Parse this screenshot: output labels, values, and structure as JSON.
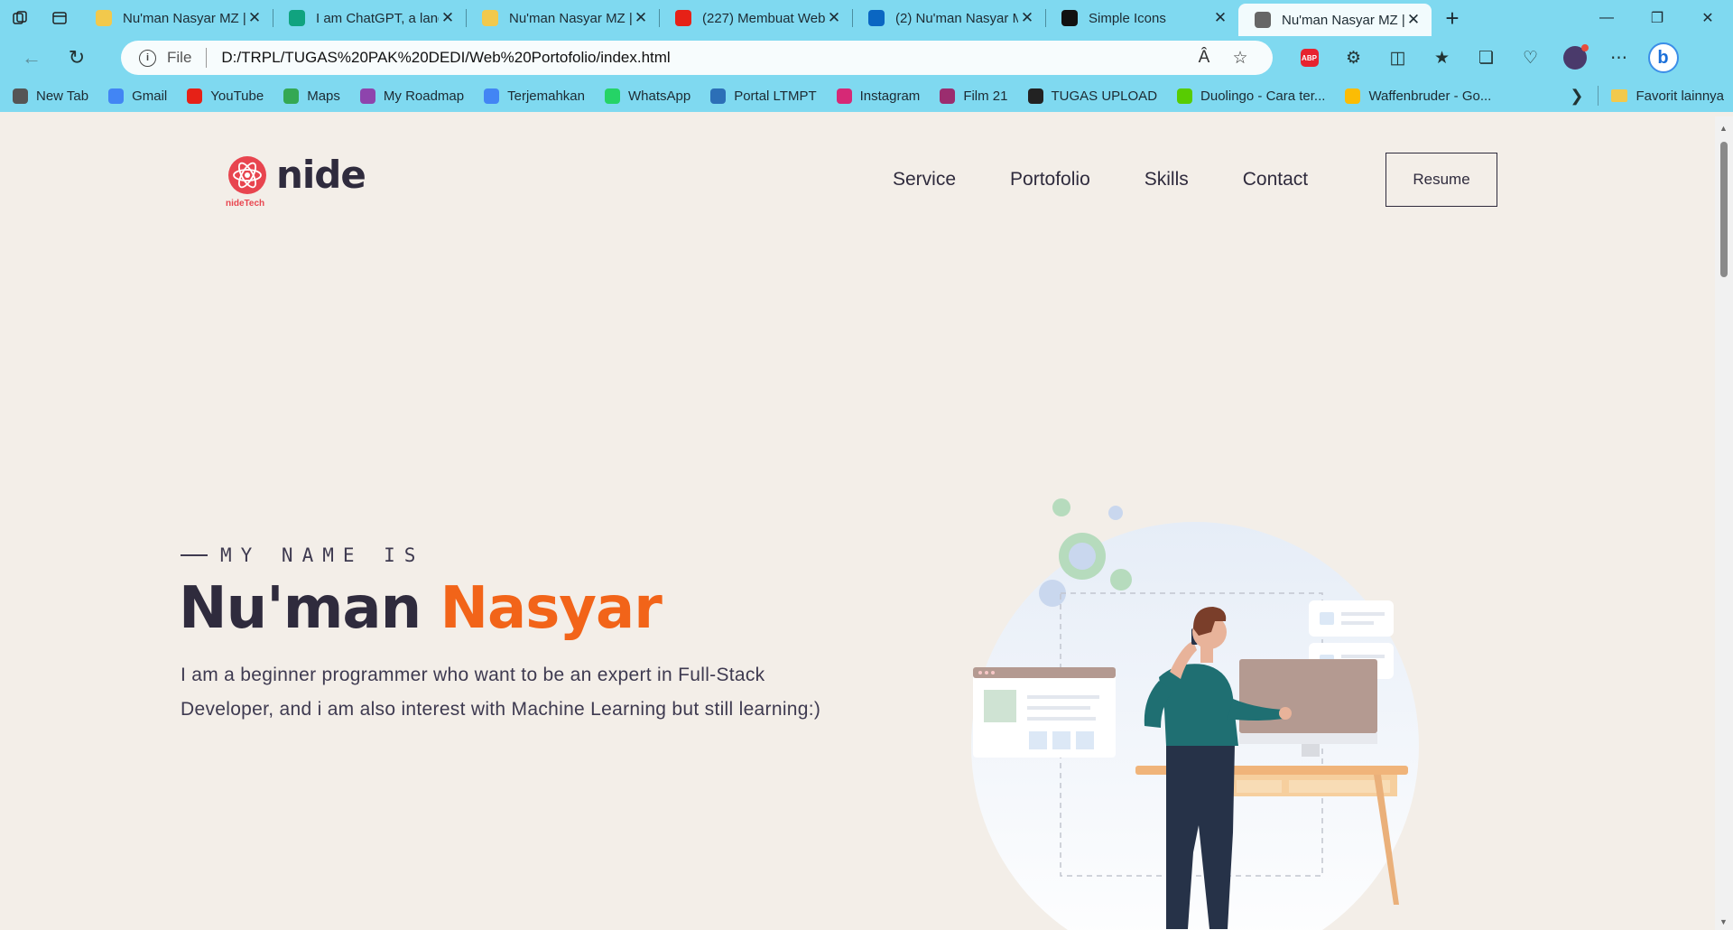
{
  "browser": {
    "tabs": [
      {
        "title": "Nu'man Nasyar MZ |",
        "favicon": "yellow-bars-favicon",
        "color": "#f2c94c"
      },
      {
        "title": "I am ChatGPT, a lang",
        "favicon": "chatgpt-favicon",
        "color": "#10a37f"
      },
      {
        "title": "Nu'man Nasyar MZ |",
        "favicon": "yellow-bars-favicon",
        "color": "#f2c94c"
      },
      {
        "title": "(227) Membuat Web",
        "favicon": "youtube-favicon",
        "color": "#e62117"
      },
      {
        "title": "(2) Nu'man Nasyar M",
        "favicon": "linkedin-favicon",
        "color": "#0a66c2"
      },
      {
        "title": "Simple Icons",
        "favicon": "simpleicons-favicon",
        "color": "#111111"
      },
      {
        "title": "Nu'man Nasyar MZ |",
        "favicon": "page-favicon",
        "color": "#666666",
        "active": true
      }
    ],
    "address": {
      "label": "File",
      "url": "D:/TRPL/TUGAS%20PAK%20DEDI/Web%20Portofolio/index.html"
    },
    "bookmarks": [
      {
        "label": "New Tab",
        "icon": "page-icon",
        "color": "#555555"
      },
      {
        "label": "Gmail",
        "icon": "google-icon",
        "color": "#4285f4"
      },
      {
        "label": "YouTube",
        "icon": "youtube-icon",
        "color": "#e62117"
      },
      {
        "label": "Maps",
        "icon": "google-icon",
        "color": "#34a853"
      },
      {
        "label": "My Roadmap",
        "icon": "roadmap-icon",
        "color": "#8e44ad"
      },
      {
        "label": "Terjemahkan",
        "icon": "translate-icon",
        "color": "#4285f4"
      },
      {
        "label": "WhatsApp",
        "icon": "whatsapp-icon",
        "color": "#25d366"
      },
      {
        "label": "Portal LTMPT",
        "icon": "ltmpt-icon",
        "color": "#2c6fb7"
      },
      {
        "label": "Instagram",
        "icon": "instagram-icon",
        "color": "#d62976"
      },
      {
        "label": "Film 21",
        "icon": "film-icon",
        "color": "#9b2d6f"
      },
      {
        "label": "TUGAS UPLOAD",
        "icon": "upload-icon",
        "color": "#222222"
      },
      {
        "label": "Duolingo - Cara ter...",
        "icon": "duolingo-icon",
        "color": "#58cc02"
      },
      {
        "label": "Waffenbruder - Go...",
        "icon": "drive-icon",
        "color": "#fbbc04"
      }
    ],
    "other_favorites": "Favorit lainnya"
  },
  "site": {
    "logo_text": "nide",
    "logo_sub": "nideTech",
    "nav": [
      "Service",
      "Portofolio",
      "Skills",
      "Contact"
    ],
    "resume_label": "Resume",
    "eyebrow": "MY NAME IS",
    "name_first": "Nu'man",
    "name_last": "Nasyar",
    "description": "I am a beginner programmer who want to be an expert in Full-Stack Developer, and i am also interest with Machine Learning but still learning:)",
    "colors": {
      "accent": "#f26419",
      "text": "#2f2b3d",
      "background": "#f3eee8",
      "logo": "#e8454f"
    }
  }
}
